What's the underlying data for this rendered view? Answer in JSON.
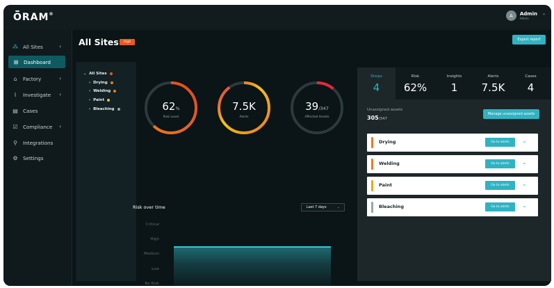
{
  "app": {
    "logo": "ORAM",
    "logo_mark": "®"
  },
  "user": {
    "initial": "A",
    "name": "Admin",
    "role": "Admin"
  },
  "sidebar": {
    "items": [
      {
        "label": "All Sites",
        "icon": "sites-icon",
        "arrow": "›",
        "active": false
      },
      {
        "label": "Dashboard",
        "icon": "dashboard-icon",
        "arrow": "",
        "active": true
      },
      {
        "label": "Factory",
        "icon": "factory-icon",
        "arrow": "›",
        "active": false
      },
      {
        "label": "Investigate",
        "icon": "investigate-icon",
        "arrow": "›",
        "active": false
      },
      {
        "label": "Cases",
        "icon": "cases-icon",
        "arrow": "",
        "active": false
      },
      {
        "label": "Compliance",
        "icon": "compliance-icon",
        "arrow": "›",
        "active": false
      },
      {
        "label": "Integrations",
        "icon": "integrations-icon",
        "arrow": "",
        "active": false
      },
      {
        "label": "Settings",
        "icon": "settings-icon",
        "arrow": "",
        "active": false
      }
    ]
  },
  "header": {
    "title": "All Sites",
    "badge": "High",
    "export_label": "Export report"
  },
  "tree": {
    "root": {
      "label": "All Sites",
      "dot_color": "#e85a1d"
    },
    "children": [
      {
        "label": "Drying",
        "dot_color": "#f07a1c"
      },
      {
        "label": "Welding",
        "dot_color": "#f07a1c"
      },
      {
        "label": "Paint",
        "dot_color": "#f2c218"
      },
      {
        "label": "Bleaching",
        "dot_color": "#9aa4a8"
      }
    ]
  },
  "gauges": [
    {
      "value": "62",
      "unit": "%",
      "label": "Risk Level",
      "fill": 0.62
    },
    {
      "value": "7.5K",
      "unit": "",
      "label": "Alerts",
      "fill": 0.9
    },
    {
      "value": "39",
      "unit": "/347",
      "label": "Affected Assets",
      "fill": 0.112
    }
  ],
  "risk_chart": {
    "title": "Risk over time",
    "range": "Last 7 days",
    "levels": [
      "Critical",
      "High",
      "Medium",
      "Low",
      "No Risk"
    ]
  },
  "tabs": [
    {
      "label": "Shops",
      "value": "4",
      "active": true
    },
    {
      "label": "Risk",
      "value": "62%",
      "active": false
    },
    {
      "label": "Insights",
      "value": "1",
      "active": false
    },
    {
      "label": "Alerts",
      "value": "7.5K",
      "active": false
    },
    {
      "label": "Cases",
      "value": "4",
      "active": false
    }
  ],
  "unassigned": {
    "label": "Unassigned assets",
    "count": "305",
    "total": "/347",
    "manage_label": "Manage unassigned assets"
  },
  "sites": [
    {
      "name": "Drying",
      "color": "#f07a1c",
      "button": "Go to alerts"
    },
    {
      "name": "Welding",
      "color": "#f07a1c",
      "button": "Go to alerts"
    },
    {
      "name": "Paint",
      "color": "#f2a618",
      "button": "Go to alerts"
    },
    {
      "name": "Bleaching",
      "color": "#9aa4a8",
      "button": "Go to alerts"
    }
  ],
  "colors": {
    "accent": "#2fb3c3",
    "active_nav": "#0e5a61",
    "high": "#e85a1d"
  }
}
